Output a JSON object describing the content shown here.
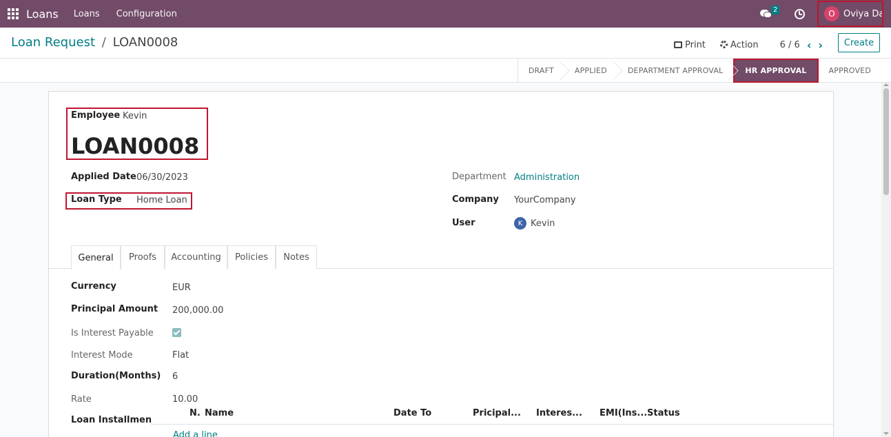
{
  "navbar": {
    "brand": "Loans",
    "menu": [
      "Loans",
      "Configuration"
    ],
    "chat_count": "2",
    "user_initial": "O",
    "user_name": "Oviya Davis"
  },
  "control_panel": {
    "breadcrumb_parent": "Loan Request",
    "breadcrumb_sep": "/",
    "breadcrumb_current": "LOAN0008",
    "print_label": "Print",
    "action_label": "Action",
    "pager": "6 / 6",
    "prev_icon": "chevron-left-icon",
    "next_icon": "chevron-right-icon",
    "create_label": "Create"
  },
  "statusbar": {
    "stages": [
      "DRAFT",
      "APPLIED",
      "DEPARTMENT APPROVAL",
      "HR APPROVAL",
      "APPROVED"
    ],
    "active_stage": "HR APPROVAL"
  },
  "form": {
    "employee_label": "Employee",
    "employee_value": "Kevin",
    "loan_name": "LOAN0008",
    "applied_date_label": "Applied Date",
    "applied_date_value": "06/30/2023",
    "loan_type_label": "Loan Type",
    "loan_type_value": "Home Loan",
    "department_label": "Department",
    "department_value": "Administration",
    "company_label": "Company",
    "company_value": "YourCompany",
    "user_label": "User",
    "user_initial": "K",
    "user_value": "Kevin"
  },
  "tabs": [
    "General",
    "Proofs",
    "Accounting",
    "Policies",
    "Notes"
  ],
  "general": {
    "currency_label": "Currency",
    "currency_value": "EUR",
    "principal_label": "Principal Amount",
    "principal_value": "200,000.00",
    "interest_payable_label": "Is Interest Payable",
    "interest_payable_checked": true,
    "interest_mode_label": "Interest Mode",
    "interest_mode_value": "Flat",
    "duration_label": "Duration(Months)",
    "duration_value": "6",
    "rate_label": "Rate",
    "rate_value": "10.00",
    "installment_label": "Loan Installment",
    "columns": [
      "N.",
      "Name",
      "Date To",
      "Pricipal...",
      "Interes...",
      "EMI(Ins...",
      "Status"
    ],
    "add_line": "Add a line"
  },
  "colors": {
    "brand": "#714b67",
    "accent": "#017e84",
    "highlight": "#c0152f"
  }
}
